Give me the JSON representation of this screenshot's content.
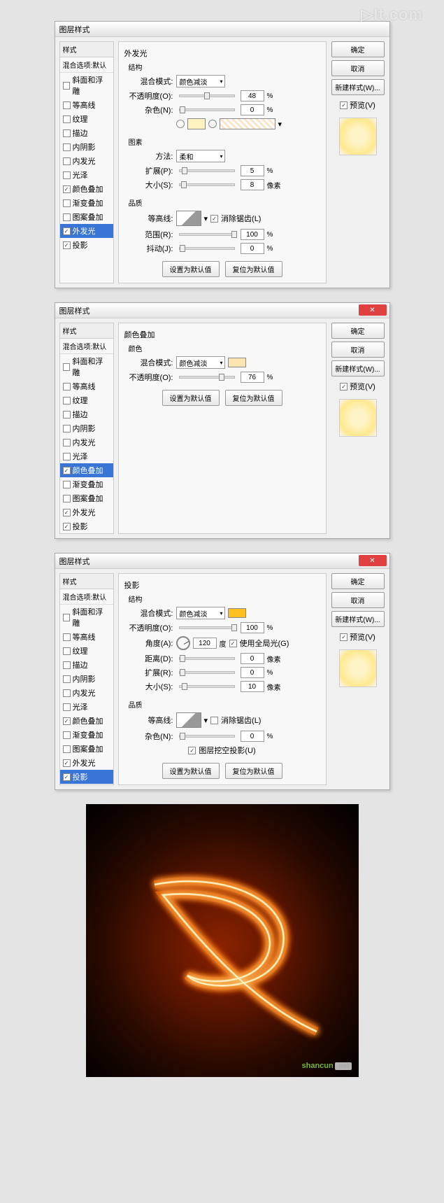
{
  "dialogs": [
    {
      "title": "图层样式",
      "panel": "外发光",
      "styles_header": "样式",
      "blend_header": "混合选项:默认",
      "effects": [
        {
          "label": "斜面和浮雕",
          "checked": false
        },
        {
          "label": "等高线",
          "checked": false
        },
        {
          "label": "纹理",
          "checked": false
        },
        {
          "label": "描边",
          "checked": false
        },
        {
          "label": "内阴影",
          "checked": false
        },
        {
          "label": "内发光",
          "checked": false
        },
        {
          "label": "光泽",
          "checked": false
        },
        {
          "label": "颜色叠加",
          "checked": true
        },
        {
          "label": "渐变叠加",
          "checked": false
        },
        {
          "label": "图案叠加",
          "checked": false
        },
        {
          "label": "外发光",
          "checked": true,
          "selected": true
        },
        {
          "label": "投影",
          "checked": true
        }
      ],
      "structure": {
        "title": "结构",
        "blend_label": "混合模式:",
        "blend_value": "颜色减淡",
        "opacity_label": "不透明度(O):",
        "opacity": "48",
        "noise_label": "杂色(N):",
        "noise": "0"
      },
      "elements": {
        "title": "图素",
        "technique_label": "方法:",
        "technique": "柔和",
        "spread_label": "扩展(P):",
        "spread": "5",
        "size_label": "大小(S):",
        "size": "8",
        "size_unit": "像素"
      },
      "quality": {
        "title": "品质",
        "contour_label": "等高线:",
        "antialias": "消除锯齿(L)",
        "range_label": "范围(R):",
        "range": "100",
        "jitter_label": "抖动(J):",
        "jitter": "0"
      },
      "color1": "#fff3c2",
      "buttons": {
        "default": "设置为默认值",
        "reset": "复位为默认值"
      },
      "right": {
        "ok": "确定",
        "cancel": "取消",
        "new": "新建样式(W)...",
        "preview": "预览(V)"
      }
    },
    {
      "title": "图层样式",
      "panel": "颜色叠加",
      "styles_header": "样式",
      "blend_header": "混合选项:默认",
      "effects": [
        {
          "label": "斜面和浮雕",
          "checked": false
        },
        {
          "label": "等高线",
          "checked": false
        },
        {
          "label": "纹理",
          "checked": false
        },
        {
          "label": "描边",
          "checked": false
        },
        {
          "label": "内阴影",
          "checked": false
        },
        {
          "label": "内发光",
          "checked": false
        },
        {
          "label": "光泽",
          "checked": false
        },
        {
          "label": "颜色叠加",
          "checked": true,
          "selected": true
        },
        {
          "label": "渐变叠加",
          "checked": false
        },
        {
          "label": "图案叠加",
          "checked": false
        },
        {
          "label": "外发光",
          "checked": true
        },
        {
          "label": "投影",
          "checked": true
        }
      ],
      "color_group": {
        "title": "颜色",
        "blend_label": "混合模式:",
        "blend_value": "颜色减淡",
        "opacity_label": "不透明度(O):",
        "opacity": "76",
        "swatch": "#fde5b2"
      },
      "buttons": {
        "default": "设置为默认值",
        "reset": "复位为默认值"
      },
      "right": {
        "ok": "确定",
        "cancel": "取消",
        "new": "新建样式(W)...",
        "preview": "预览(V)"
      }
    },
    {
      "title": "图层样式",
      "panel": "投影",
      "styles_header": "样式",
      "blend_header": "混合选项:默认",
      "effects": [
        {
          "label": "斜面和浮雕",
          "checked": false
        },
        {
          "label": "等高线",
          "checked": false
        },
        {
          "label": "纹理",
          "checked": false
        },
        {
          "label": "描边",
          "checked": false
        },
        {
          "label": "内阴影",
          "checked": false
        },
        {
          "label": "内发光",
          "checked": false
        },
        {
          "label": "光泽",
          "checked": false
        },
        {
          "label": "颜色叠加",
          "checked": true
        },
        {
          "label": "渐变叠加",
          "checked": false
        },
        {
          "label": "图案叠加",
          "checked": false
        },
        {
          "label": "外发光",
          "checked": true
        },
        {
          "label": "投影",
          "checked": true,
          "selected": true
        }
      ],
      "structure": {
        "title": "结构",
        "blend_label": "混合模式:",
        "blend_value": "颜色减淡",
        "swatch": "#ffc020",
        "opacity_label": "不透明度(O):",
        "opacity": "100",
        "angle_label": "角度(A):",
        "angle": "120",
        "angle_unit": "度",
        "global": "使用全局光(G)",
        "distance_label": "距离(D):",
        "distance": "0",
        "spread_label": "扩展(R):",
        "spread": "0",
        "size_label": "大小(S):",
        "size": "10",
        "px": "像素"
      },
      "quality": {
        "title": "品质",
        "contour_label": "等高线:",
        "antialias": "消除锯齿(L)",
        "noise_label": "杂色(N):",
        "noise": "0",
        "knockout": "图层挖空投影(U)"
      },
      "buttons": {
        "default": "设置为默认值",
        "reset": "复位为默认值"
      },
      "right": {
        "ok": "确定",
        "cancel": "取消",
        "new": "新建样式(W)...",
        "preview": "预览(V)"
      }
    }
  ],
  "wm": {
    "brand": "shancun",
    "suffix": ".net"
  }
}
